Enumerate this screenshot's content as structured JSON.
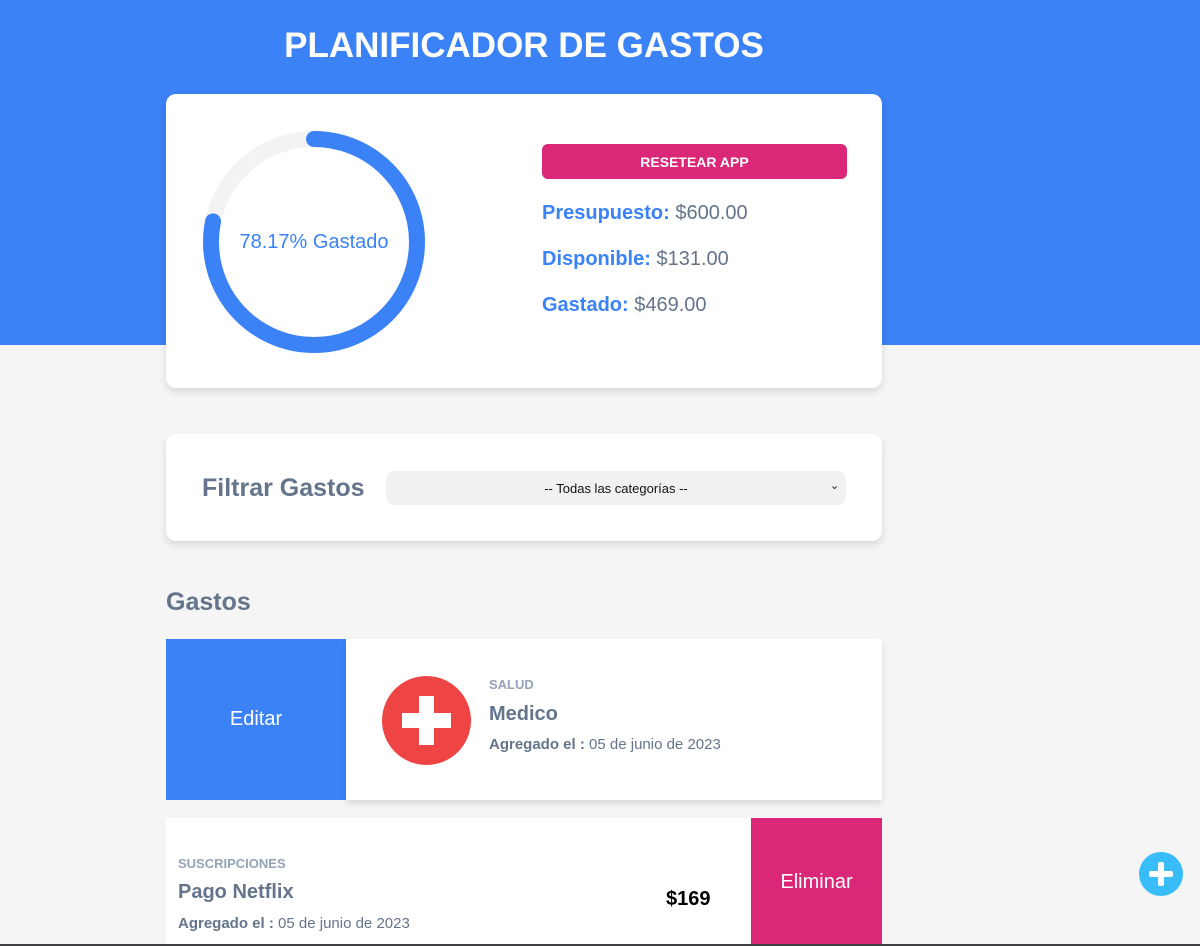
{
  "header": {
    "title": "PLANIFICADOR DE GASTOS"
  },
  "budget": {
    "percent_spent": 78.17,
    "ring_label": "78.17% Gastado",
    "reset_label": "RESETEAR APP",
    "presupuesto_label": "Presupuesto:",
    "presupuesto_value": "$600.00",
    "disponible_label": "Disponible:",
    "disponible_value": "$131.00",
    "gastado_label": "Gastado:",
    "gastado_value": "$469.00"
  },
  "filter": {
    "label": "Filtrar Gastos",
    "selected": "-- Todas las categorías --"
  },
  "expenses": {
    "title": "Gastos",
    "edit_label": "Editar",
    "delete_label": "Eliminar",
    "date_prefix": "Agregado el :",
    "items": [
      {
        "category": "SALUD",
        "name": "Medico",
        "date": "05 de junio de 2023",
        "icon": "health-cross-icon"
      },
      {
        "category": "SUSCRIPCIONES",
        "name": "Pago Netflix",
        "date": "05 de junio de 2023",
        "amount": "$169"
      }
    ]
  },
  "colors": {
    "primary": "#3b82f6",
    "accent": "#db2777",
    "health": "#ef4444",
    "fab": "#38bdf8"
  }
}
